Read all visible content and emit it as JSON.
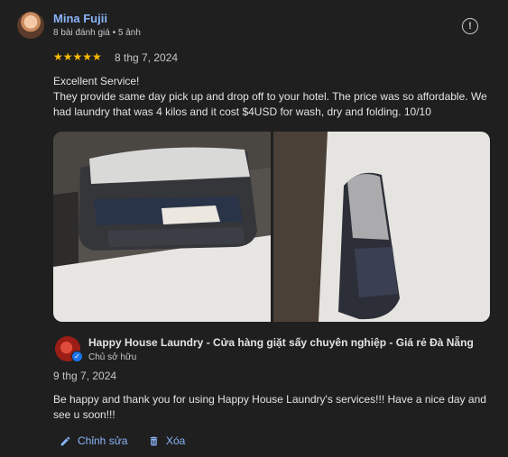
{
  "review": {
    "reviewer_name": "Mina Fujii",
    "reviewer_meta": "8 bài đánh giá • 5 ảnh",
    "rating": 5,
    "stars_text": "★★★★★",
    "date": "8 thg 7, 2024",
    "text_lines": [
      "Excellent Service!",
      "They provide same day pick up and drop off to your hotel. The price was so affordable. We had laundry that was 4 kilos and it cost $4USD for wash, dry and folding. 10/10"
    ],
    "more_icon": "!"
  },
  "owner_reply": {
    "business_name": "Happy House Laundry - Cửa hàng giặt sấy chuyên nghiệp - Giá rẻ Đà Nẵng",
    "role": "Chủ sở hữu",
    "date": "9 thg 7, 2024",
    "text": "Be happy and thank you for using Happy House Laundry's services!!! Have a nice day and see u soon!!!",
    "badge_icon": "✓"
  },
  "actions": {
    "edit_label": "Chỉnh sửa",
    "delete_label": "Xóa"
  },
  "colors": {
    "background": "#1f1f1f",
    "link": "#8ab4f8",
    "star": "#fbbc04",
    "text": "#e3e3e3",
    "muted": "#c4c7c5"
  },
  "icons": {
    "more": "info-circle-icon",
    "edit": "pencil-icon",
    "delete": "trash-icon",
    "verified": "checkmark-badge-icon"
  }
}
